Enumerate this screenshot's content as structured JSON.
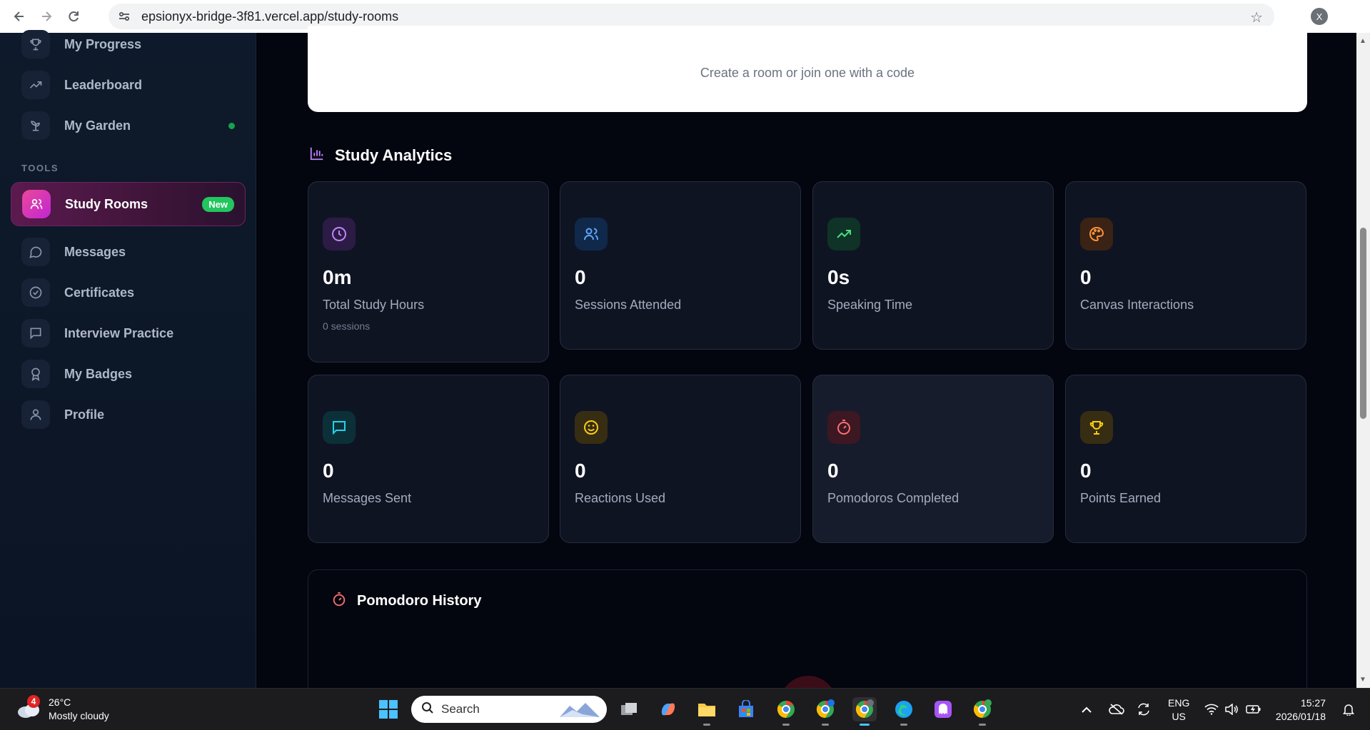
{
  "browser": {
    "url": "epsionyx-bridge-3f81.vercel.app/study-rooms",
    "profile_initial": "X"
  },
  "sidebar": {
    "items_top": [
      {
        "label": "My Progress",
        "icon": "trophy-icon"
      },
      {
        "label": "Leaderboard",
        "icon": "trending-up-icon"
      },
      {
        "label": "My Garden",
        "icon": "sprout-icon"
      }
    ],
    "section_tools": "TOOLS",
    "active_item": {
      "label": "Study Rooms",
      "badge": "New",
      "icon": "users-icon"
    },
    "items_tools": [
      {
        "label": "Messages",
        "icon": "message-circle-icon"
      },
      {
        "label": "Certificates",
        "icon": "check-circle-icon"
      },
      {
        "label": "Interview Practice",
        "icon": "message-square-icon"
      },
      {
        "label": "My Badges",
        "icon": "award-icon"
      },
      {
        "label": "Profile",
        "icon": "user-icon"
      }
    ]
  },
  "rooms_card": {
    "subtitle": "Create a room or join one with a code"
  },
  "analytics": {
    "title": "Study Analytics",
    "stats": [
      {
        "value": "0m",
        "label": "Total Study Hours",
        "meta": "0 sessions",
        "icon": "clock-icon",
        "color": "#c084fc"
      },
      {
        "value": "0",
        "label": "Sessions Attended",
        "icon": "users-icon",
        "color": "#60a5fa"
      },
      {
        "value": "0s",
        "label": "Speaking Time",
        "icon": "trending-up-icon",
        "color": "#4ade80"
      },
      {
        "value": "0",
        "label": "Canvas Interactions",
        "icon": "palette-icon",
        "color": "#fb923c"
      },
      {
        "value": "0",
        "label": "Messages Sent",
        "icon": "message-square-icon",
        "color": "#22d3ee"
      },
      {
        "value": "0",
        "label": "Reactions Used",
        "icon": "smile-icon",
        "color": "#facc15"
      },
      {
        "value": "0",
        "label": "Pomodoros Completed",
        "icon": "timer-icon",
        "color": "#f87171"
      },
      {
        "value": "0",
        "label": "Points Earned",
        "icon": "trophy-icon",
        "color": "#facc15"
      }
    ]
  },
  "pomodoro": {
    "title": "Pomodoro History"
  },
  "taskbar": {
    "weather_badge": "4",
    "temperature": "26°C",
    "condition": "Mostly cloudy",
    "search_placeholder": "Search",
    "lang_line1": "ENG",
    "lang_line2": "US",
    "time": "15:27",
    "date": "2026/01/18"
  }
}
